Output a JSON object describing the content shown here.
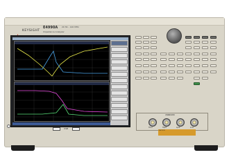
{
  "brand": {
    "name": "KEYSIGHT",
    "accent_color": "#c0392b"
  },
  "model": {
    "number": "E4990A",
    "subtitle": "Impedance Analyzer",
    "spec": "20 Hz - 120 MHz"
  },
  "screen": {
    "menu_color": "#9ab0c8",
    "softkey_highlight": "#5c6f90",
    "trace_colors": [
      "#e8e84a",
      "#4aa3e8",
      "#e84ae0",
      "#59e07a"
    ]
  },
  "front_panel": {
    "usb_label": "USB",
    "connector_labels": [
      "Hcur",
      "Hpot",
      "Lpot",
      "Lcur"
    ],
    "connector_panel_label": "UNKNOWN",
    "warning_label": "CAUTION"
  }
}
